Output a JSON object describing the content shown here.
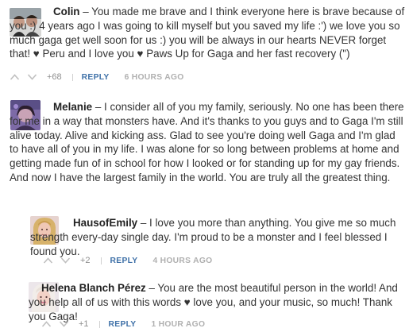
{
  "comments": [
    {
      "author": "Colin",
      "body": " – You made me brave and I think everyone here is brave because of you :) 4 years ago I was going to kill myself but you saved my life :') we love you so much gaga get well soon for us :) you will be always in our hearts NEVER forget that! ♥ Peru and I love you ♥ Paws Up for Gaga and her fast recovery (\")",
      "votes": "+68",
      "reply_label": "REPLY",
      "time": "6 HOURS AGO"
    },
    {
      "author": "Melanie",
      "body": " – I consider all of you my family, seriously. No one has been there for me in a way that monsters have. And it's thanks to you guys and to Gaga I'm still alive today. Alive and kicking ass. Glad to see you're doing well Gaga and I'm glad to have all of you in my life. I was alone for so long between problems at home and getting made fun of in school for how I looked or for standing up for my gay friends. And now I have the largest family in the world. You are truly all the greatest thing.",
      "votes": "",
      "reply_label": "",
      "time": ""
    },
    {
      "author": "HausofEmily",
      "body": " – I love you more than anything. You give me so much strength every-day single day. I'm proud to be a monster and I feel blessed I found you.",
      "votes": "+2",
      "reply_label": "REPLY",
      "time": "4 HOURS AGO"
    },
    {
      "author": "Helena Blanch Pérez",
      "body": " – You are the most beautiful person in the world! And you help all of us with this words ♥ love you, and your music, so much! Thank you Gaga!",
      "votes": "+1",
      "reply_label": "REPLY",
      "time": "1 HOUR AGO"
    }
  ],
  "icons": {
    "upvote": "chevron-up-icon",
    "downvote": "chevron-down-icon"
  }
}
